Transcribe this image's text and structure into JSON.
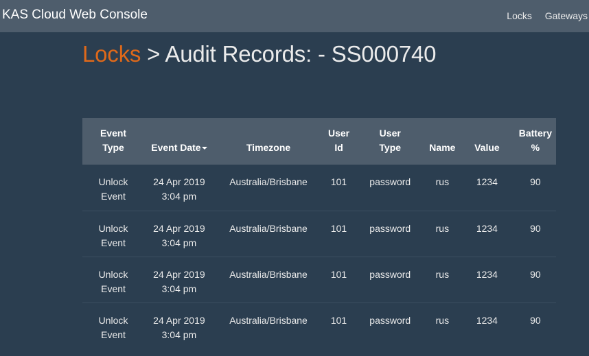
{
  "navbar": {
    "brand": "KAS Cloud Web Console",
    "links": [
      "Locks",
      "Gateways"
    ]
  },
  "page": {
    "breadcrumb_link": "Locks",
    "title_rest": " > Audit Records: - SS000740"
  },
  "colors": {
    "background": "#2b3e50",
    "navbar": "#4e5d6c",
    "accent": "#df691a",
    "text": "#ebebeb"
  },
  "table": {
    "sort_column": "Event Date",
    "sort_direction": "descending",
    "columns": [
      {
        "line1": "Event",
        "line2": "Type"
      },
      {
        "line1": "",
        "line2": "Event Date"
      },
      {
        "line1": "",
        "line2": "Timezone"
      },
      {
        "line1": "User",
        "line2": "Id"
      },
      {
        "line1": "User",
        "line2": "Type"
      },
      {
        "line1": "",
        "line2": "Name"
      },
      {
        "line1": "",
        "line2": "Value"
      },
      {
        "line1": "Battery",
        "line2": "%"
      }
    ],
    "rows": [
      {
        "event_type": [
          "Unlock",
          "Event"
        ],
        "event_date": [
          "24 Apr 2019",
          "3:04 pm"
        ],
        "timezone": "Australia/Brisbane",
        "user_id": "101",
        "user_type": "password",
        "name": "rus",
        "value": "1234",
        "battery": "90"
      },
      {
        "event_type": [
          "Unlock",
          "Event"
        ],
        "event_date": [
          "24 Apr 2019",
          "3:04 pm"
        ],
        "timezone": "Australia/Brisbane",
        "user_id": "101",
        "user_type": "password",
        "name": "rus",
        "value": "1234",
        "battery": "90"
      },
      {
        "event_type": [
          "Unlock",
          "Event"
        ],
        "event_date": [
          "24 Apr 2019",
          "3:04 pm"
        ],
        "timezone": "Australia/Brisbane",
        "user_id": "101",
        "user_type": "password",
        "name": "rus",
        "value": "1234",
        "battery": "90"
      },
      {
        "event_type": [
          "Unlock",
          "Event"
        ],
        "event_date": [
          "24 Apr 2019",
          "3:04 pm"
        ],
        "timezone": "Australia/Brisbane",
        "user_id": "101",
        "user_type": "password",
        "name": "rus",
        "value": "1234",
        "battery": "90"
      }
    ]
  }
}
